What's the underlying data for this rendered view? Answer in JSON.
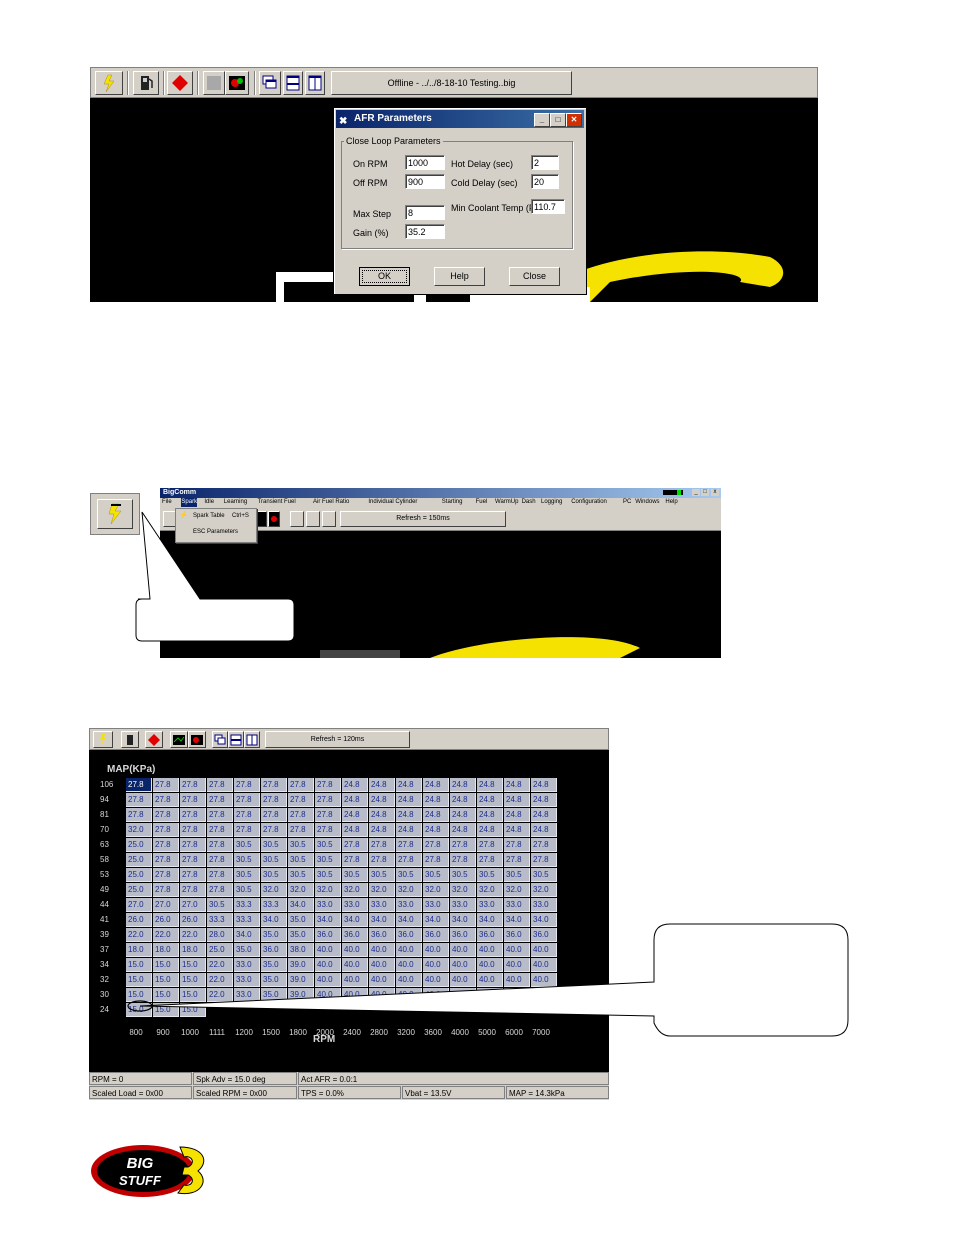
{
  "top_window": {
    "status_text": "Offline - ../../8-18-10 Testing..big"
  },
  "afr_dialog": {
    "title": "AFR Parameters",
    "group_label": "Close Loop Parameters",
    "on_rpm_label": "On RPM",
    "on_rpm_value": "1000",
    "off_rpm_label": "Off RPM",
    "off_rpm_value": "900",
    "max_step_label": "Max Step",
    "max_step_value": "8",
    "gain_label": "Gain (%)",
    "gain_value": "35.2",
    "hot_delay_label": "Hot Delay (sec)",
    "hot_delay_value": "2",
    "cold_delay_label": "Cold Delay (sec)",
    "cold_delay_value": "20",
    "min_coolant_label": "Min Coolant Temp (F)",
    "min_coolant_value": "110.7",
    "ok_label": "OK",
    "help_label": "Help",
    "close_label": "Close"
  },
  "middle_window": {
    "app_title": "BigComm",
    "menu": [
      "File",
      "Spark",
      "Idle",
      "Learning",
      "Transient Fuel",
      "Air Fuel Ratio",
      "Individual Cylinder",
      "Starting",
      "Fuel",
      "WarmUp",
      "Dash",
      "Logging",
      "Configuration",
      "PC",
      "Windows",
      "Help"
    ],
    "dropdown": {
      "item1": "Spark Table",
      "item1_shortcut": "Ctrl+S",
      "item2": "ESC Parameters"
    },
    "status_text": "Refresh = 150ms"
  },
  "spark_table": {
    "toolbar_status": "Refresh = 120ms",
    "y_axis_label": "MAP(KPa)",
    "x_axis_label": "RPM",
    "map_values": [
      "106",
      "94",
      "81",
      "70",
      "63",
      "58",
      "53",
      "49",
      "44",
      "41",
      "39",
      "37",
      "34",
      "32",
      "30",
      "24"
    ],
    "rpm_values": [
      "800",
      "900",
      "1000",
      "1111",
      "1200",
      "1500",
      "1800",
      "2000",
      "2400",
      "2800",
      "3200",
      "3600",
      "4000",
      "5000",
      "6000",
      "7000"
    ],
    "rows": [
      [
        "27.8",
        "27.8",
        "27.8",
        "27.8",
        "27.8",
        "27.8",
        "27.8",
        "27.8",
        "24.8",
        "24.8",
        "24.8",
        "24.8",
        "24.8",
        "24.8",
        "24.8",
        "24.8"
      ],
      [
        "27.8",
        "27.8",
        "27.8",
        "27.8",
        "27.8",
        "27.8",
        "27.8",
        "27.8",
        "24.8",
        "24.8",
        "24.8",
        "24.8",
        "24.8",
        "24.8",
        "24.8",
        "24.8"
      ],
      [
        "27.8",
        "27.8",
        "27.8",
        "27.8",
        "27.8",
        "27.8",
        "27.8",
        "27.8",
        "24.8",
        "24.8",
        "24.8",
        "24.8",
        "24.8",
        "24.8",
        "24.8",
        "24.8"
      ],
      [
        "32.0",
        "27.8",
        "27.8",
        "27.8",
        "27.8",
        "27.8",
        "27.8",
        "27.8",
        "24.8",
        "24.8",
        "24.8",
        "24.8",
        "24.8",
        "24.8",
        "24.8",
        "24.8"
      ],
      [
        "25.0",
        "27.8",
        "27.8",
        "27.8",
        "30.5",
        "30.5",
        "30.5",
        "30.5",
        "27.8",
        "27.8",
        "27.8",
        "27.8",
        "27.8",
        "27.8",
        "27.8",
        "27.8"
      ],
      [
        "25.0",
        "27.8",
        "27.8",
        "27.8",
        "30.5",
        "30.5",
        "30.5",
        "30.5",
        "27.8",
        "27.8",
        "27.8",
        "27.8",
        "27.8",
        "27.8",
        "27.8",
        "27.8"
      ],
      [
        "25.0",
        "27.8",
        "27.8",
        "27.8",
        "30.5",
        "30.5",
        "30.5",
        "30.5",
        "30.5",
        "30.5",
        "30.5",
        "30.5",
        "30.5",
        "30.5",
        "30.5",
        "30.5"
      ],
      [
        "25.0",
        "27.8",
        "27.8",
        "27.8",
        "30.5",
        "32.0",
        "32.0",
        "32.0",
        "32.0",
        "32.0",
        "32.0",
        "32.0",
        "32.0",
        "32.0",
        "32.0",
        "32.0"
      ],
      [
        "27.0",
        "27.0",
        "27.0",
        "30.5",
        "33.3",
        "33.3",
        "34.0",
        "33.0",
        "33.0",
        "33.0",
        "33.0",
        "33.0",
        "33.0",
        "33.0",
        "33.0",
        "33.0"
      ],
      [
        "26.0",
        "26.0",
        "26.0",
        "33.3",
        "33.3",
        "34.0",
        "35.0",
        "34.0",
        "34.0",
        "34.0",
        "34.0",
        "34.0",
        "34.0",
        "34.0",
        "34.0",
        "34.0"
      ],
      [
        "22.0",
        "22.0",
        "22.0",
        "28.0",
        "34.0",
        "35.0",
        "35.0",
        "36.0",
        "36.0",
        "36.0",
        "36.0",
        "36.0",
        "36.0",
        "36.0",
        "36.0",
        "36.0"
      ],
      [
        "18.0",
        "18.0",
        "18.0",
        "25.0",
        "35.0",
        "36.0",
        "38.0",
        "40.0",
        "40.0",
        "40.0",
        "40.0",
        "40.0",
        "40.0",
        "40.0",
        "40.0",
        "40.0"
      ],
      [
        "15.0",
        "15.0",
        "15.0",
        "22.0",
        "33.0",
        "35.0",
        "39.0",
        "40.0",
        "40.0",
        "40.0",
        "40.0",
        "40.0",
        "40.0",
        "40.0",
        "40.0",
        "40.0"
      ],
      [
        "15.0",
        "15.0",
        "15.0",
        "22.0",
        "33.0",
        "35.0",
        "39.0",
        "40.0",
        "40.0",
        "40.0",
        "40.0",
        "40.0",
        "40.0",
        "40.0",
        "40.0",
        "40.0"
      ],
      [
        "15.0",
        "15.0",
        "15.0",
        "22.0",
        "33.0",
        "35.0",
        "39.0",
        "40.0",
        "40.0",
        "40.0",
        "40.0",
        "40.0",
        "40.0",
        "40.0",
        "40.0",
        "40.0"
      ],
      [
        "15.0",
        "15.0",
        "15.0",
        "",
        "",
        "",
        "",
        "",
        "",
        "",
        "",
        "",
        "",
        "",
        "",
        ""
      ]
    ],
    "status_row1": [
      "RPM = 0",
      "Spk Adv = 15.0 deg",
      "Act AFR = 0.0:1"
    ],
    "status_row2": [
      "Scaled Load = 0x00",
      "Scaled RPM = 0x00",
      "TPS = 0.0%",
      "Vbat = 13.5V",
      "MAP = 14.3kPa"
    ]
  },
  "logo": {
    "text": "BIG STUFF 3"
  }
}
